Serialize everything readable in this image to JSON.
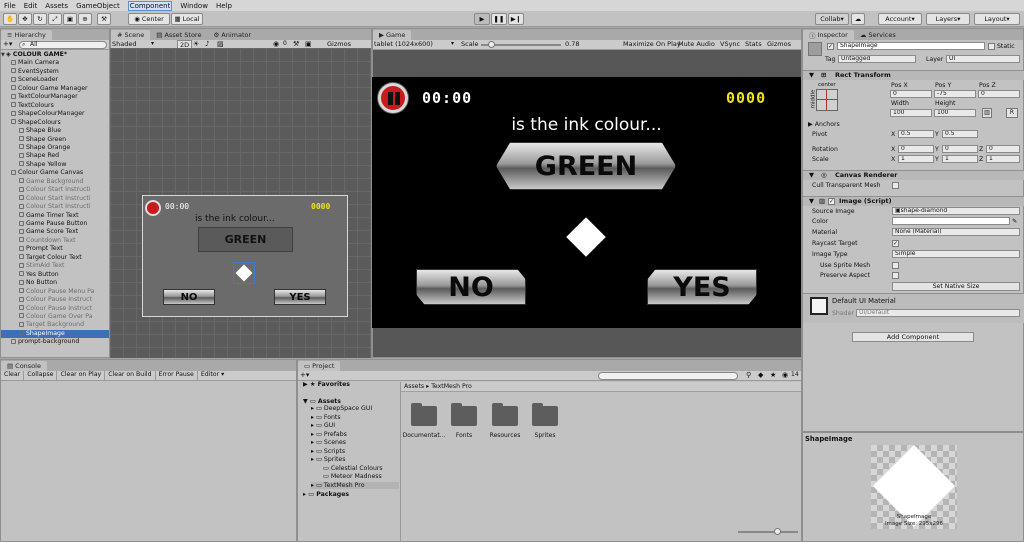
{
  "menubar": [
    "File",
    "Edit",
    "Assets",
    "GameObject",
    "Component",
    "Window",
    "Help"
  ],
  "toolbar": {
    "center": "Center",
    "local": "Local",
    "collab": "Collab",
    "account": "Account",
    "layers": "Layers",
    "layout": "Layout"
  },
  "hierarchy": {
    "tab": "Hierarchy",
    "search": "All",
    "scene_name": "COLOUR GAME*",
    "items": [
      {
        "label": "Main Camera",
        "depth": 1,
        "state": "normal"
      },
      {
        "label": "EventSystem",
        "depth": 1,
        "state": "normal"
      },
      {
        "label": "SceneLoader",
        "depth": 1,
        "state": "normal"
      },
      {
        "label": "Colour Game Manager",
        "depth": 1,
        "state": "normal"
      },
      {
        "label": "TextColourManager",
        "depth": 1,
        "state": "normal"
      },
      {
        "label": "TextColours",
        "depth": 1,
        "state": "normal"
      },
      {
        "label": "ShapeColourManager",
        "depth": 1,
        "state": "normal"
      },
      {
        "label": "ShapeColours",
        "depth": 1,
        "state": "normal"
      },
      {
        "label": "Shape Blue",
        "depth": 2,
        "state": "normal"
      },
      {
        "label": "Shape Green",
        "depth": 2,
        "state": "normal"
      },
      {
        "label": "Shape Orange",
        "depth": 2,
        "state": "normal"
      },
      {
        "label": "Shape Red",
        "depth": 2,
        "state": "normal"
      },
      {
        "label": "Shape Yellow",
        "depth": 2,
        "state": "normal"
      },
      {
        "label": "Colour Game Canvas",
        "depth": 1,
        "state": "normal"
      },
      {
        "label": "Game Background",
        "depth": 2,
        "state": "dim"
      },
      {
        "label": "Colour Start Instructi",
        "depth": 2,
        "state": "dim"
      },
      {
        "label": "Colour Start Instructi",
        "depth": 2,
        "state": "dim"
      },
      {
        "label": "Colour Start Instructi",
        "depth": 2,
        "state": "dim"
      },
      {
        "label": "Game Timer Text",
        "depth": 2,
        "state": "normal"
      },
      {
        "label": "Game Pause Button",
        "depth": 2,
        "state": "normal"
      },
      {
        "label": "Game Score Text",
        "depth": 2,
        "state": "normal"
      },
      {
        "label": "Countdown Text",
        "depth": 2,
        "state": "dim"
      },
      {
        "label": "Prompt Text",
        "depth": 2,
        "state": "normal"
      },
      {
        "label": "Target Colour Text",
        "depth": 2,
        "state": "normal"
      },
      {
        "label": "StimAid Text",
        "depth": 2,
        "state": "dim"
      },
      {
        "label": "Yes Button",
        "depth": 2,
        "state": "normal"
      },
      {
        "label": "No Button",
        "depth": 2,
        "state": "normal"
      },
      {
        "label": "Colour Pause Menu Pa",
        "depth": 2,
        "state": "dim"
      },
      {
        "label": "Colour Pause Instruct",
        "depth": 2,
        "state": "dim"
      },
      {
        "label": "Colour Pause Instruct",
        "depth": 2,
        "state": "dim"
      },
      {
        "label": "Colour Game Over Pa",
        "depth": 2,
        "state": "dim"
      },
      {
        "label": "Target Background",
        "depth": 2,
        "state": "dim"
      },
      {
        "label": "ShapeImage",
        "depth": 2,
        "state": "selected"
      },
      {
        "label": "prompt-background",
        "depth": 1,
        "state": "normal"
      }
    ]
  },
  "scene": {
    "tabs": [
      "Scene",
      "Asset Store",
      "Animator"
    ],
    "shaded": "Shaded",
    "mode": "2D",
    "gizmos": "Gizmos",
    "timer": "00:00",
    "score": "0000",
    "prompt": "is the ink colour...",
    "target": "GREEN",
    "no": "NO",
    "yes": "YES"
  },
  "game": {
    "tab": "Game",
    "resolution": "tablet (1024x600)",
    "scale_label": "Scale",
    "scale_value": "0.78",
    "scale_fraction": 0.12,
    "options": [
      "Maximize On Play",
      "Mute Audio",
      "VSync",
      "Stats",
      "Gizmos"
    ],
    "timer": "00:00",
    "score": "0000",
    "prompt": "is the ink colour...",
    "target": "GREEN",
    "no": "NO",
    "yes": "YES",
    "colors": {
      "score": "#f0e21c",
      "pause": "#c81c1c",
      "canvas": "#000000"
    }
  },
  "inspector": {
    "tabs": [
      "Inspector",
      "Services"
    ],
    "object_name": "ShapeImage",
    "static": "Static",
    "tag_label": "Tag",
    "tag": "Untagged",
    "layer_label": "Layer",
    "layer": "UI",
    "rect_transform": {
      "title": "Rect Transform",
      "anchor_h": "center",
      "anchor_v": "middle",
      "posx_label": "Pos X",
      "posx": "0",
      "posy_label": "Pos Y",
      "posy": "-75",
      "posz_label": "Pos Z",
      "posz": "0",
      "width_label": "Width",
      "width": "100",
      "height_label": "Height",
      "height": "100",
      "r_button": "R",
      "anchors": "Anchors",
      "pivot": "Pivot",
      "pivot_x": "0.5",
      "pivot_y": "0.5",
      "rotation": "Rotation",
      "rot_x": "0",
      "rot_y": "0",
      "rot_z": "0",
      "scale": "Scale",
      "scale_x": "1",
      "scale_y": "1",
      "scale_z": "1",
      "x": "X",
      "y": "Y",
      "z": "Z"
    },
    "canvas_renderer": {
      "title": "Canvas Renderer",
      "cull": "Cull Transparent Mesh"
    },
    "image": {
      "title": "Image (Script)",
      "source_image_label": "Source Image",
      "source_image": "shape-diamond",
      "color_label": "Color",
      "material_label": "Material",
      "material": "None (Material)",
      "raycast_label": "Raycast Target",
      "image_type_label": "Image Type",
      "image_type": "Simple",
      "use_sprite_mesh": "Use Sprite Mesh",
      "preserve_aspect": "Preserve Aspect",
      "set_native": "Set Native Size"
    },
    "material": {
      "name": "Default UI Material",
      "shader_label": "Shader",
      "shader": "UI/Default"
    },
    "add_component": "Add Component",
    "preview_title": "ShapeImage",
    "preview_caption1": "ShapeImage",
    "preview_caption2": "Image Size: 295x296"
  },
  "console": {
    "tab": "Console",
    "buttons": [
      "Clear",
      "Collapse",
      "Clear on Play",
      "Clear on Build",
      "Error Pause",
      "Editor"
    ]
  },
  "project": {
    "tab": "Project",
    "favorites": "Favorites",
    "assets": "Assets",
    "tree": [
      {
        "label": "DeepSpace GUI",
        "depth": 1
      },
      {
        "label": "Fonts",
        "depth": 1
      },
      {
        "label": "GUI",
        "depth": 1
      },
      {
        "label": "Prefabs",
        "depth": 1
      },
      {
        "label": "Scenes",
        "depth": 1
      },
      {
        "label": "Scripts",
        "depth": 1
      },
      {
        "label": "Sprites",
        "depth": 1
      },
      {
        "label": "Celestial Colours",
        "depth": 2
      },
      {
        "label": "Meteor Madness",
        "depth": 2
      },
      {
        "label": "TextMesh Pro",
        "depth": 1
      },
      {
        "label": "Packages",
        "depth": 0
      }
    ],
    "breadcrumb_root": "Assets",
    "breadcrumb_leaf": "TextMesh Pro",
    "count": "14",
    "folders": [
      "Documentat...",
      "Fonts",
      "Resources",
      "Sprites"
    ]
  }
}
